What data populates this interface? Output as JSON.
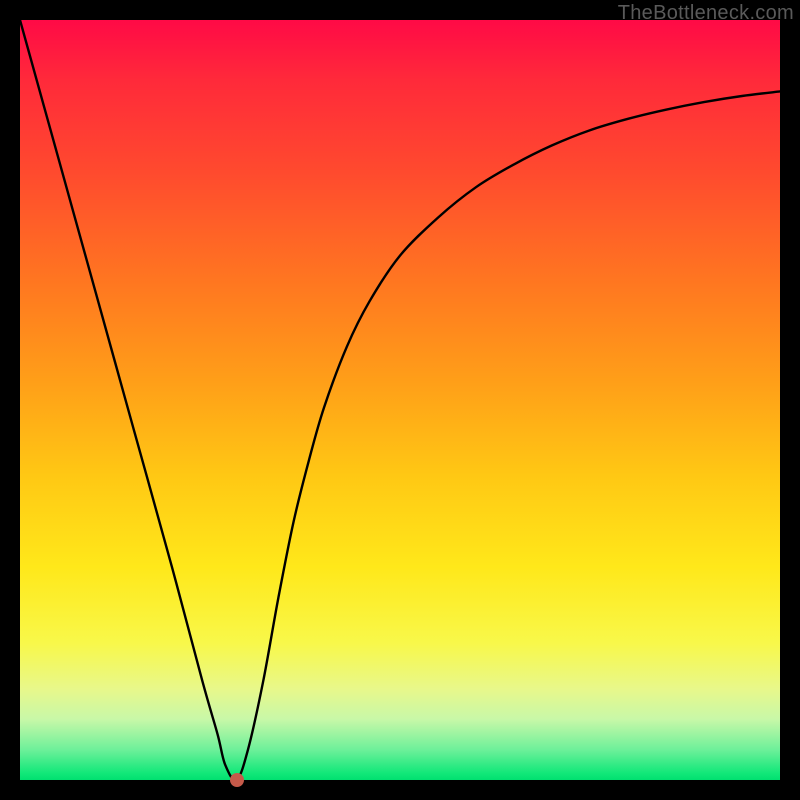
{
  "watermark": "TheBottleneck.com",
  "dot": {
    "x_pct": 28.5,
    "y_pct": 100
  },
  "chart_data": {
    "type": "line",
    "title": "",
    "xlabel": "",
    "ylabel": "",
    "xlim": [
      0,
      100
    ],
    "ylim": [
      0,
      100
    ],
    "series": [
      {
        "name": "bottleneck-curve",
        "x": [
          0,
          5,
          10,
          15,
          20,
          24,
          26,
          27,
          28.5,
          30,
          32,
          34,
          36,
          38,
          40,
          43,
          46,
          50,
          55,
          60,
          65,
          70,
          75,
          80,
          85,
          90,
          95,
          100
        ],
        "values": [
          100,
          82,
          64,
          46,
          28,
          13,
          6,
          2,
          0,
          4,
          13,
          24,
          34,
          42,
          49,
          57,
          63,
          69,
          74,
          78,
          81,
          83.5,
          85.5,
          87,
          88.2,
          89.2,
          90,
          90.6
        ]
      }
    ],
    "marker": {
      "x": 28.5,
      "y": 0
    },
    "background_gradient": {
      "top": "#ff0a46",
      "bottom": "#00e070"
    }
  }
}
